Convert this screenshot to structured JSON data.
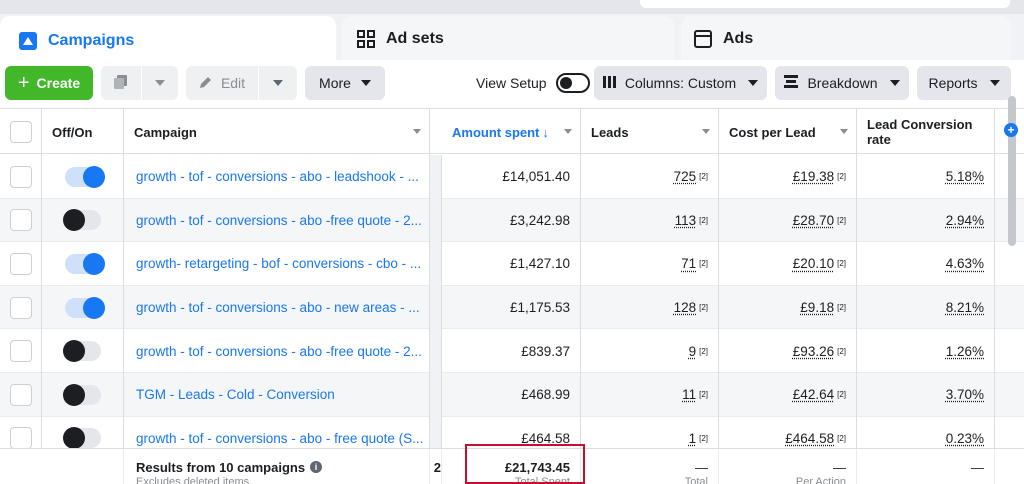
{
  "tabs": [
    {
      "label": "Campaigns",
      "icon": "campaign-flag-icon",
      "active": true
    },
    {
      "label": "Ad sets",
      "icon": "grid-icon",
      "active": false
    },
    {
      "label": "Ads",
      "icon": "window-icon",
      "active": false
    }
  ],
  "toolbar": {
    "create_label": "Create",
    "edit_label": "Edit",
    "more_label": "More",
    "view_setup_label": "View Setup",
    "columns_label": "Columns: Custom",
    "breakdown_label": "Breakdown",
    "reports_label": "Reports"
  },
  "columns": {
    "offon": "Off/On",
    "campaign": "Campaign",
    "amount": "Amount spent",
    "leads": "Leads",
    "cpl": "Cost per Lead",
    "lcr": "Lead Conversion rate"
  },
  "rows": [
    {
      "on": true,
      "campaign": "growth - tof - conversions - abo - leadshook - ...",
      "amount": "£14,051.40",
      "leads": "725",
      "leads_fn": "[2]",
      "cpl": "£19.38",
      "cpl_fn": "[2]",
      "lcr": "5.18%"
    },
    {
      "on": false,
      "campaign": "growth - tof - conversions - abo -free quote - 2...",
      "amount": "£3,242.98",
      "leads": "113",
      "leads_fn": "[2]",
      "cpl": "£28.70",
      "cpl_fn": "[2]",
      "lcr": "2.94%"
    },
    {
      "on": true,
      "campaign": "growth- retargeting - bof - conversions - cbo - ...",
      "amount": "£1,427.10",
      "leads": "71",
      "leads_fn": "[2]",
      "cpl": "£20.10",
      "cpl_fn": "[2]",
      "lcr": "4.63%"
    },
    {
      "on": true,
      "campaign": "growth - tof - conversions - abo - new areas - ...",
      "amount": "£1,175.53",
      "leads": "128",
      "leads_fn": "[2]",
      "cpl": "£9.18",
      "cpl_fn": "[2]",
      "lcr": "8.21%"
    },
    {
      "on": false,
      "campaign": "growth - tof - conversions - abo -free quote - 2...",
      "amount": "£839.37",
      "leads": "9",
      "leads_fn": "[2]",
      "cpl": "£93.26",
      "cpl_fn": "[2]",
      "lcr": "1.26%"
    },
    {
      "on": false,
      "campaign": "TGM - Leads - Cold - Conversion",
      "amount": "£468.99",
      "leads": "11",
      "leads_fn": "[2]",
      "cpl": "£42.64",
      "cpl_fn": "[2]",
      "lcr": "3.70%"
    },
    {
      "on": false,
      "campaign": "growth - tof - conversions - abo - free quote (S...",
      "amount": "£464.58",
      "leads": "1",
      "leads_fn": "[2]",
      "cpl": "£464.58",
      "cpl_fn": "[2]",
      "lcr": "0.23%"
    }
  ],
  "footer": {
    "results_label": "Results from 10 campaigns",
    "excludes_label": "Excludes deleted items",
    "amount_total": "£21,743.45",
    "amount_sub": "Total Spent",
    "leads_total": "—",
    "leads_sub": "Total",
    "cpl_total": "—",
    "cpl_sub": "Per Action",
    "lcr_total": "—",
    "partial_num": "2"
  },
  "colors": {
    "accent": "#1877f2",
    "create": "#42b72a",
    "highlight_box": "#c8102e"
  }
}
